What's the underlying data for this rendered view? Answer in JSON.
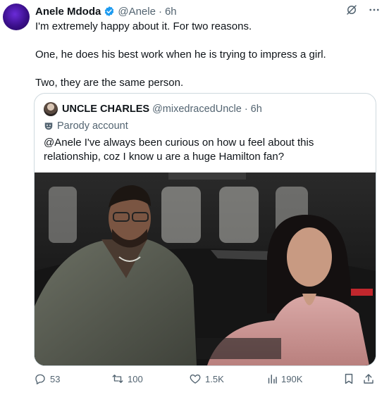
{
  "author": {
    "name": "Anele Mdoda",
    "handle": "@Anele",
    "separator": "·",
    "time": "6h"
  },
  "tweet": {
    "line1": "I'm extremely happy about it. For two reasons.",
    "line2": "One, he does his best work when he is trying to impress a girl.",
    "line3": "Two, they are the same person."
  },
  "quote": {
    "name": "UNCLE CHARLES",
    "handle": "@mixedracedUncle",
    "separator": "·",
    "time": "6h",
    "label": "Parody account",
    "text": "@Anele I've always been curious on how u feel about this relationship, coz I know u are a huge Hamilton fan?"
  },
  "actions": {
    "replies": "53",
    "reposts": "100",
    "likes": "1.5K",
    "views": "190K"
  },
  "colors": {
    "verified": "#1d9bf0",
    "muted": "#536471",
    "border": "#cfd9de"
  }
}
